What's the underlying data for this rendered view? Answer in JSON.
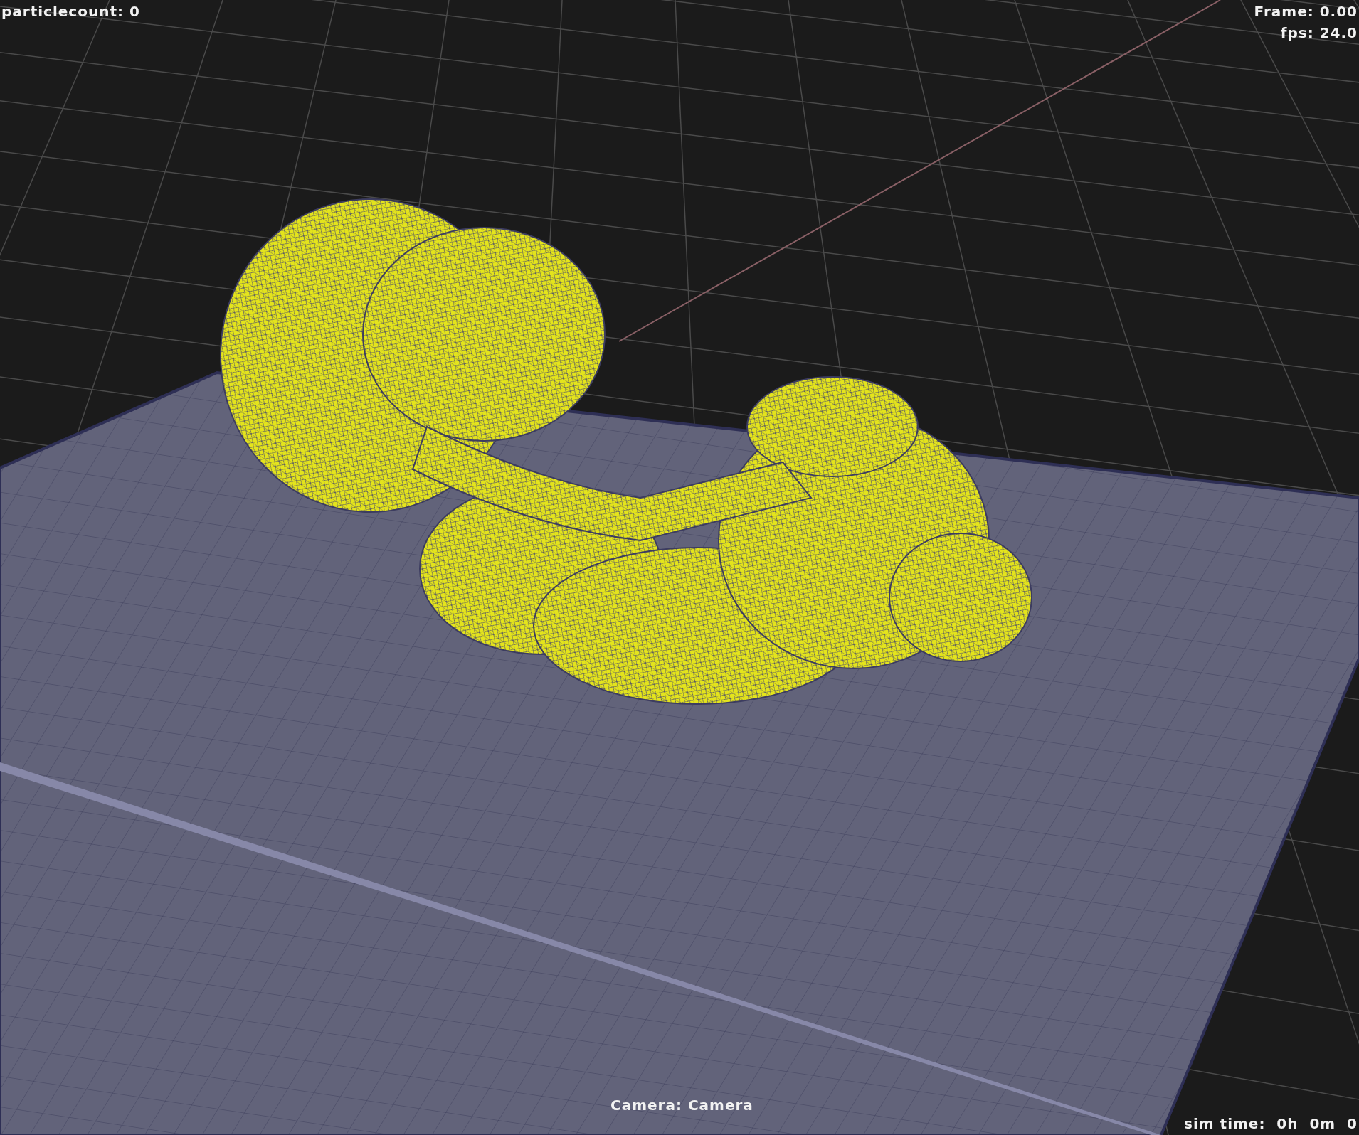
{
  "viewport": {
    "hud": {
      "particle_count": "particlecount: 0",
      "frame": "Frame: 0.00",
      "fps": "fps: 24.0",
      "camera": "Camera: Camera",
      "sim_time": "sim time:  0h  0m  0"
    }
  }
}
